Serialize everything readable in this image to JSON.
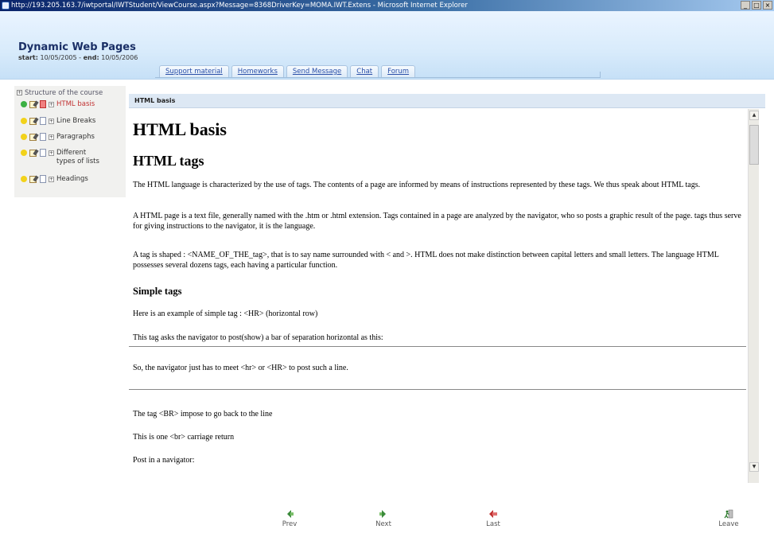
{
  "window": {
    "title": "http://193.205.163.7/iwtportal/IWTStudent/ViewCourse.aspx?Message=8368DriverKey=MOMA.IWT.Extens - Microsoft Internet Explorer",
    "minimize": "_",
    "maximize": "□",
    "close": "×"
  },
  "header": {
    "course_title": "Dynamic Web Pages",
    "start_label": "start:",
    "start_date": "10/05/2005",
    "sep": "-",
    "end_label": "end:",
    "end_date": "10/05/2006",
    "tabs": [
      "Support material",
      "Homeworks",
      "Send Message",
      "Chat",
      "Forum"
    ]
  },
  "sidebar": {
    "structure_label": "Structure of the course",
    "items": [
      {
        "label": "HTML basis",
        "dot_color": "#3cb043",
        "active": true
      },
      {
        "label": "Line Breaks",
        "dot_color": "#f2d21a",
        "active": false
      },
      {
        "label": "Paragraphs",
        "dot_color": "#f2d21a",
        "active": false
      },
      {
        "label": "Different types of lists",
        "dot_color": "#f2d21a",
        "active": false
      },
      {
        "label": "Headings",
        "dot_color": "#f2d21a",
        "active": false
      }
    ]
  },
  "content": {
    "breadcrumb": "HTML basis",
    "h1": "HTML basis",
    "h2": "HTML tags",
    "p1": "The HTML language is characterized by the use of tags. The contents of a page are informed by means of instructions represented by these tags. We thus speak about HTML tags.",
    "p2": "A HTML page is a text file, generally named with the .htm or .html extension. Tags contained in a page are analyzed by the navigator, who so posts a graphic result of the page. tags thus serve for giving instructions to the navigator, it is the language.",
    "p3": "A tag is shaped : <NAME_OF_THE_tag>, that is to say name surrounded with < and >. HTML does not make distinction between capital letters and small letters. The language HTML possesses several dozens tags, each having a particular function.",
    "h3": "Simple tags",
    "p4": "Here is an example of simple tag : <HR> (horizontal row)",
    "p5": "This tag asks the navigator to post(show) a bar of separation horizontal as this:",
    "p6": "So, the navigator just has to meet <hr> or <HR> to post such a line.",
    "p7": "The tag <BR> impose to go back to the line",
    "p8": "This is one <br> carriage return",
    "p9": "Post in a navigator:"
  },
  "scrollbar": {
    "up": "▲",
    "down": "▼"
  },
  "footer": {
    "prev": "Prev",
    "next": "Next",
    "last": "Last",
    "leave": "Leave"
  },
  "colors": {
    "accent_blue": "#1a2f66",
    "active_red": "#c03030",
    "header_bg": "#d8ebfb"
  }
}
